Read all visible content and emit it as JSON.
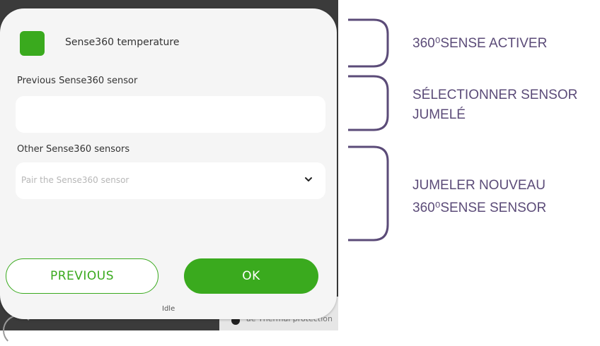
{
  "dialog": {
    "toggle": {
      "label": "Sense360 temperature",
      "checked": true
    },
    "previous_sensor": {
      "label": "Previous Sense360 sensor",
      "value": ""
    },
    "other_sensors": {
      "label": "Other Sense360 sensors",
      "placeholder": "Pair the Sense360 sensor"
    },
    "buttons": {
      "previous": "PREVIOUS",
      "ok": "OK"
    },
    "status": "Idle"
  },
  "background": {
    "partial_text": "ae Thermal protection"
  },
  "annotations": [
    {
      "line1": "360⁰SENSE ACTIVER"
    },
    {
      "line1": "SÉLECTIONNER SENSOR",
      "line2": "JUMELÉ"
    },
    {
      "line1": "JUMELER NOUVEAU",
      "line2": "360⁰SENSE SENSOR"
    }
  ],
  "colors": {
    "accent_green": "#3aaa1e",
    "annotation_purple": "#5b4b78",
    "dialog_background": "#f5f5f5"
  },
  "icons": {
    "select_chevron": "chevron-down-icon"
  }
}
